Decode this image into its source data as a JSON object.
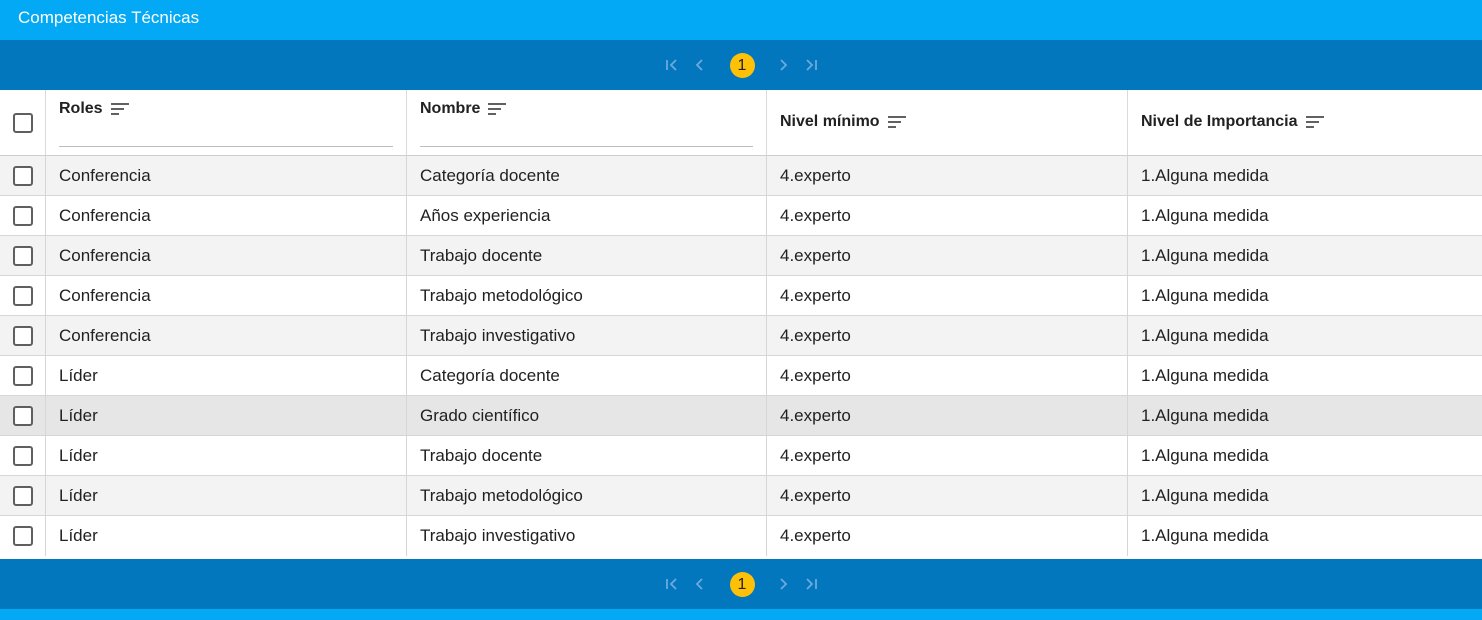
{
  "window": {
    "title": "Competencias Técnicas"
  },
  "pager": {
    "current_page": "1"
  },
  "columns": {
    "roles": "Roles",
    "nombre": "Nombre",
    "nivel_minimo": "Nivel mínimo",
    "nivel_importancia": "Nivel de Importancia"
  },
  "rows": [
    {
      "rol": "Conferencia",
      "nombre": "Categoría docente",
      "nivel_minimo": "4.experto",
      "importancia": "1.Alguna medida"
    },
    {
      "rol": "Conferencia",
      "nombre": "Años experiencia",
      "nivel_minimo": "4.experto",
      "importancia": "1.Alguna medida"
    },
    {
      "rol": "Conferencia",
      "nombre": "Trabajo docente",
      "nivel_minimo": "4.experto",
      "importancia": "1.Alguna medida"
    },
    {
      "rol": "Conferencia",
      "nombre": "Trabajo metodológico",
      "nivel_minimo": "4.experto",
      "importancia": "1.Alguna medida"
    },
    {
      "rol": "Conferencia",
      "nombre": "Trabajo investigativo",
      "nivel_minimo": "4.experto",
      "importancia": "1.Alguna medida"
    },
    {
      "rol": "Líder",
      "nombre": "Categoría docente",
      "nivel_minimo": "4.experto",
      "importancia": "1.Alguna medida"
    },
    {
      "rol": "Líder",
      "nombre": "Grado científico",
      "nivel_minimo": "4.experto",
      "importancia": "1.Alguna medida"
    },
    {
      "rol": "Líder",
      "nombre": "Trabajo docente",
      "nivel_minimo": "4.experto",
      "importancia": "1.Alguna medida"
    },
    {
      "rol": "Líder",
      "nombre": "Trabajo metodológico",
      "nivel_minimo": "4.experto",
      "importancia": "1.Alguna medida"
    },
    {
      "rol": "Líder",
      "nombre": "Trabajo investigativo",
      "nivel_minimo": "4.experto",
      "importancia": "1.Alguna medida"
    }
  ],
  "colors": {
    "title_bar": "#03a9f4",
    "pager_bar": "#0277bd",
    "current_page_badge": "#ffc107"
  },
  "icons": [
    "first-page-icon",
    "prev-page-icon",
    "next-page-icon",
    "last-page-icon",
    "sort-icon",
    "checkbox-icon"
  ]
}
